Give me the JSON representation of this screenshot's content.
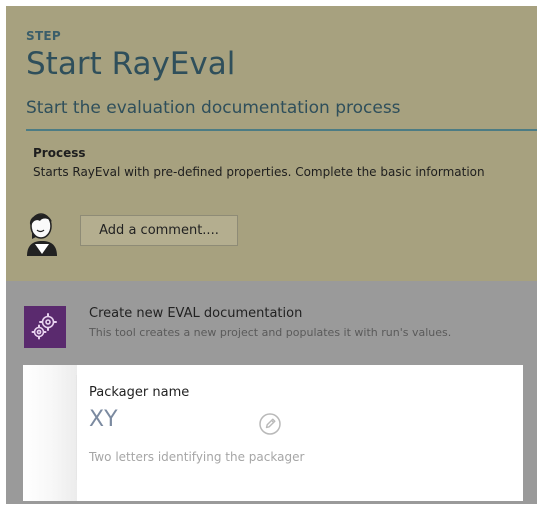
{
  "step": {
    "label": "STEP",
    "title": "Start RayEval",
    "subtitle": "Start the evaluation documentation process",
    "process_heading": "Process",
    "process_text": "Starts RayEval with pre-defined properties. Complete the basic information",
    "comment_button": "Add a comment...."
  },
  "tool": {
    "title": "Create new EVAL documentation",
    "description": "This tool creates a new project and populates it with run's values."
  },
  "field": {
    "label": "Packager name",
    "value": "XY",
    "hint": "Two letters identifying the packager"
  },
  "icons": {
    "avatar": "user-avatar-icon",
    "tool": "gears-icon",
    "edit": "pencil-circle-icon"
  },
  "colors": {
    "step_panel": "#a7a17f",
    "heading_text": "#2f4f5b",
    "divider": "#4c7c84",
    "tool_icon_bg": "#5a2a6e",
    "field_value": "#7b8aa0"
  }
}
